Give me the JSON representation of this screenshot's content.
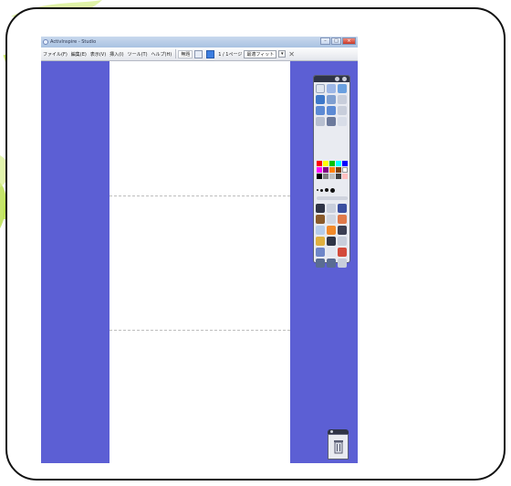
{
  "window": {
    "title": "ActivInspire - Studio"
  },
  "menu": {
    "items": [
      "ファイル(F)",
      "編集(E)",
      "表示(V)",
      "挿入(I)",
      "ツール(T)",
      "ヘルプ(H)"
    ],
    "pen_label": "無題",
    "page_indicator": "1 / 1ページ",
    "zoom": "最適フィット"
  },
  "colors": {
    "workspace": "#5c5fd4",
    "page": "#ffffff",
    "frame_border": "#111111",
    "leaf_green": "#c9e86a"
  },
  "palette": [
    "#ff0000",
    "#ffff00",
    "#00c000",
    "#00ffff",
    "#0000ff",
    "#ff00ff",
    "#800080",
    "#ff8000",
    "#804000",
    "#ffffff",
    "#000000",
    "#808080",
    "#c0c0c0",
    "#404040",
    "#ffc0c0"
  ],
  "icons": {
    "toolbox": [
      "select-icon",
      "pen-icon",
      "marker-icon",
      "highlighter-icon",
      "eraser-icon",
      "shape-icon",
      "connector-icon",
      "text-icon",
      "fill-icon",
      "camera-icon",
      "magic-ink-icon",
      "zoom-icon",
      "clock-icon",
      "undo-icon",
      "redo-icon"
    ],
    "trash": "trash-icon"
  }
}
